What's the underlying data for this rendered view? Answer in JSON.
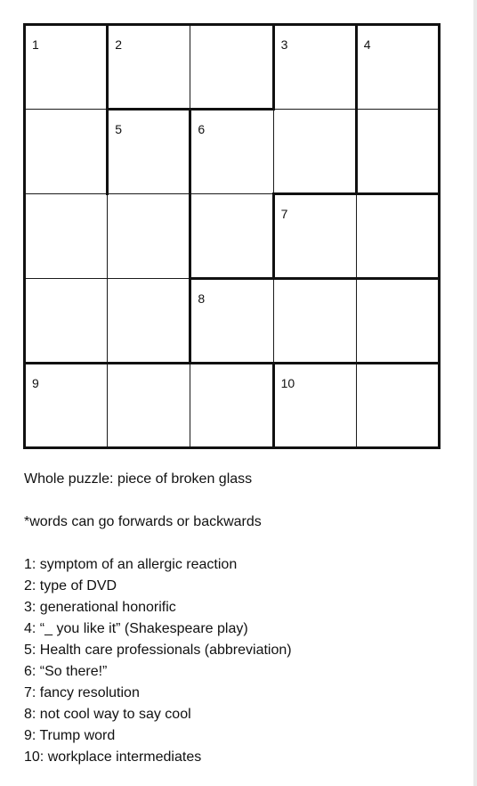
{
  "grid": {
    "rows": 5,
    "cols": 5,
    "numbers": [
      {
        "row": 0,
        "col": 0,
        "label": "1"
      },
      {
        "row": 0,
        "col": 1,
        "label": "2"
      },
      {
        "row": 0,
        "col": 3,
        "label": "3"
      },
      {
        "row": 0,
        "col": 4,
        "label": "4"
      },
      {
        "row": 1,
        "col": 1,
        "label": "5"
      },
      {
        "row": 1,
        "col": 2,
        "label": "6"
      },
      {
        "row": 2,
        "col": 3,
        "label": "7"
      },
      {
        "row": 3,
        "col": 2,
        "label": "8"
      },
      {
        "row": 4,
        "col": 0,
        "label": "9"
      },
      {
        "row": 4,
        "col": 3,
        "label": "10"
      }
    ]
  },
  "theme": "Whole puzzle: piece of broken glass",
  "note": "*words can go forwards or backwards",
  "clues": [
    "1: symptom of an allergic reaction",
    "2: type of DVD",
    "3: generational honorific",
    "4: “_ you like it” (Shakespeare play)",
    "5: Health care professionals (abbreviation)",
    "6: “So there!”",
    "7: fancy resolution",
    "8: not cool way to say cool",
    "9: Trump word",
    "10: workplace intermediates"
  ]
}
